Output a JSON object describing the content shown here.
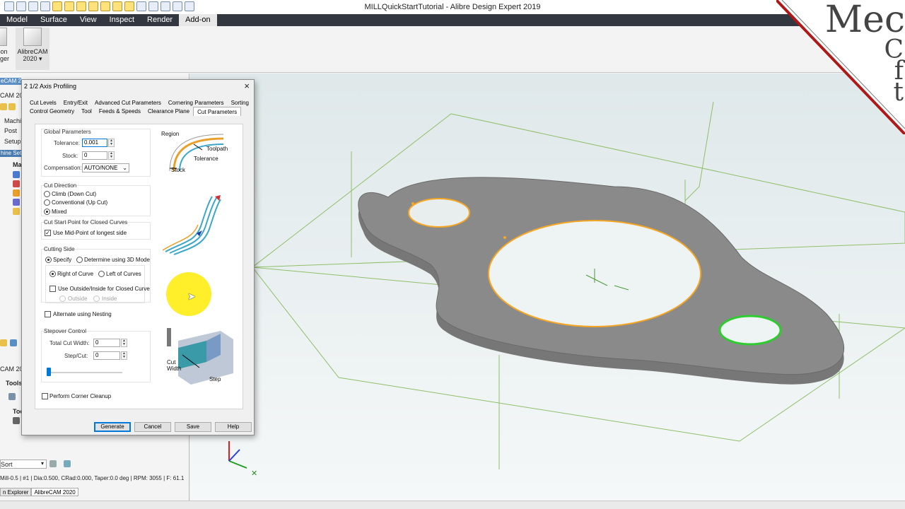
{
  "app": {
    "title": "MILLQuickStartTutorial - Alibre Design Expert 2019"
  },
  "menu": {
    "items": [
      "Model",
      "Surface",
      "View",
      "Inspect",
      "Render",
      "Add-on"
    ],
    "active": "Add-on"
  },
  "ribbon": {
    "addon_manager_line1": "-on",
    "addon_manager_line2": "ager",
    "alibrecam_line1": "AlibreCAM",
    "alibrecam_line2": "2020 ▾"
  },
  "left_panel": {
    "header1": "eCAM 2",
    "header2": "CAM 20",
    "items": [
      "Machi",
      "Post",
      "Setup"
    ],
    "tree_root": "Mac",
    "machine_setup": "hine Setu",
    "section_cam": "CAM 20",
    "section_tools": "Tools",
    "tool_item": "Too",
    "sort_label": "Sort",
    "tool_status": "Mill-0.5 | #1 | Dia:0.500, CRad:0.000, Taper:0.0 deg | RPM: 3055 | F: 61.1",
    "tabs": [
      "n Explorer",
      "AlibreCAM 2020"
    ]
  },
  "dialog": {
    "title": "2 1/2 Axis Profiling",
    "close": "×",
    "tabs_row1": [
      "Cut Levels",
      "Entry/Exit",
      "Advanced Cut Parameters",
      "Cornering Parameters",
      "Sorting"
    ],
    "tabs_row2": [
      "Control Geometry",
      "Tool",
      "Feeds & Speeds",
      "Clearance Plane",
      "Cut Parameters"
    ],
    "active_tab": "Cut Parameters",
    "global_parameters": {
      "label": "Global Parameters",
      "tolerance_label": "Tolerance:",
      "tolerance_value": "0.001",
      "stock_label": "Stock:",
      "stock_value": "0",
      "compensation_label": "Compensation:",
      "compensation_value": "AUTO/NONE"
    },
    "cut_direction": {
      "label": "Cut Direction",
      "options": [
        "Climb (Down Cut)",
        "Conventional (Up Cut)",
        "Mixed"
      ],
      "selected": "Mixed"
    },
    "cut_start": {
      "label": "Cut Start Point for Closed Curves",
      "option": "Use Mid-Point of longest side",
      "checked": true
    },
    "cutting_side": {
      "label": "Cutting Side",
      "specify": "Specify",
      "determine": "Determine using 3D Mode",
      "right": "Right of Curve",
      "left": "Left of Curves",
      "outside_inside": "Use Outside/Inside for Closed Curve",
      "outside": "Outside",
      "inside": "Inside",
      "alternate": "Alternate using Nesting"
    },
    "stepover": {
      "label": "Stepover Control",
      "total_label": "Total Cut Width:",
      "total_value": "0",
      "step_label": "Step/Cut:",
      "step_value": "0",
      "slider_value": 0
    },
    "corner_cleanup": "Perform Corner Cleanup",
    "illustration": {
      "region": "Region",
      "toolpath": "Toolpath",
      "tolerance": "Tolerance",
      "stock": "Stock",
      "cut_width": "Cut\nWidth",
      "step": "Step"
    },
    "buttons": {
      "generate": "Generate",
      "cancel": "Cancel",
      "save": "Save",
      "help": "Help"
    }
  },
  "watermark": {
    "lines": [
      "Mec",
      "C",
      "f",
      "t"
    ]
  },
  "colors": {
    "menubar": "#333840",
    "highlight": "#ffee2a",
    "part": "#898989",
    "edge": "#f5a623",
    "selected_hole": "#2fcc2f",
    "wire": "#8fbf6a"
  }
}
